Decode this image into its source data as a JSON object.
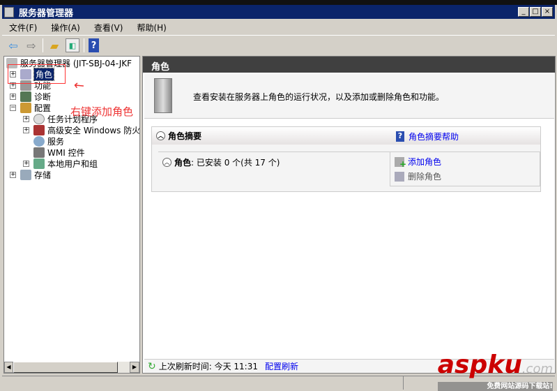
{
  "window": {
    "title": "服务器管理器",
    "minimize": "_",
    "maximize": "□",
    "close": "×"
  },
  "menu": [
    "文件(F)",
    "操作(A)",
    "查看(V)",
    "帮助(H)"
  ],
  "tree": {
    "root": "服务器管理器 (JIT-SBJ-04-JKF",
    "items": [
      {
        "label": "角色",
        "expander": "+"
      },
      {
        "label": "功能",
        "expander": "+"
      },
      {
        "label": "诊断",
        "expander": "+"
      },
      {
        "label": "配置",
        "expander": "−"
      },
      {
        "label": "任务计划程序",
        "expander": "+"
      },
      {
        "label": "高级安全 Windows 防火墙",
        "expander": "+"
      },
      {
        "label": "服务",
        "expander": ""
      },
      {
        "label": "WMI 控件",
        "expander": ""
      },
      {
        "label": "本地用户和组",
        "expander": "+"
      },
      {
        "label": "存储",
        "expander": "+"
      }
    ]
  },
  "annotation": "右键添加角色",
  "right": {
    "header": "角色",
    "intro": "查看安装在服务器上角色的运行状况，以及添加或删除角色和功能。",
    "section_title": "角色摘要",
    "help_link": "角色摘要帮助",
    "roles_label": "角色",
    "roles_status": ": 已安装 0 个(共 17 个)",
    "add_role": "添加角色",
    "remove_role": "删除角色",
    "last_refresh": "上次刷新时间: 今天 11:31",
    "config_refresh": "配置刷新"
  },
  "watermark": {
    "brand": "aspku",
    "suffix": ".com",
    "tagline": "免费网站源码下载站!"
  }
}
